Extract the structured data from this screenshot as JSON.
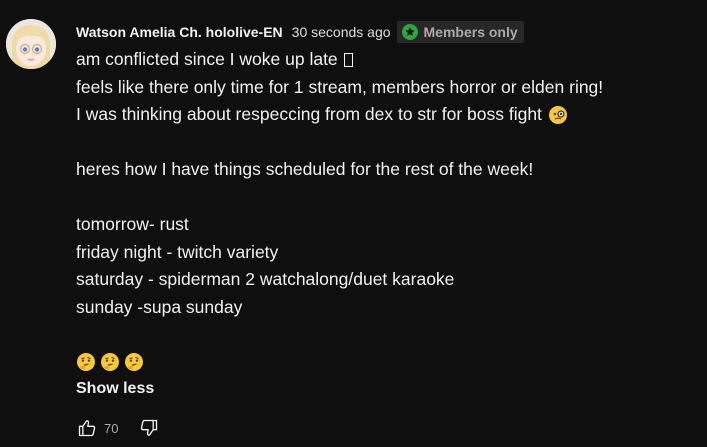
{
  "comment": {
    "author": "Watson Amelia Ch. hololive-EN",
    "timestamp": "30 seconds ago",
    "badge": {
      "label": "Members only",
      "icon": "member-star-icon",
      "icon_color": "#2ba640"
    },
    "lines": [
      "am conflicted since I woke up late",
      "feels like there only time for 1 stream, members horror or elden ring!",
      "I was thinking about respeccing from dex to str for boss fight",
      "",
      "heres how I have things scheduled for the rest of the week!",
      "",
      "tomorrow- rust",
      "friday night - twitch variety",
      "saturday - spiderman 2 watchalong/duet karaoke",
      "sunday -supa sunday"
    ],
    "emojis": [
      "monocle-face-emoji",
      "thinking-face-emoji",
      "thinking-face-emoji",
      "thinking-face-emoji"
    ],
    "toggle_label": "Show less",
    "like_count": "70"
  }
}
